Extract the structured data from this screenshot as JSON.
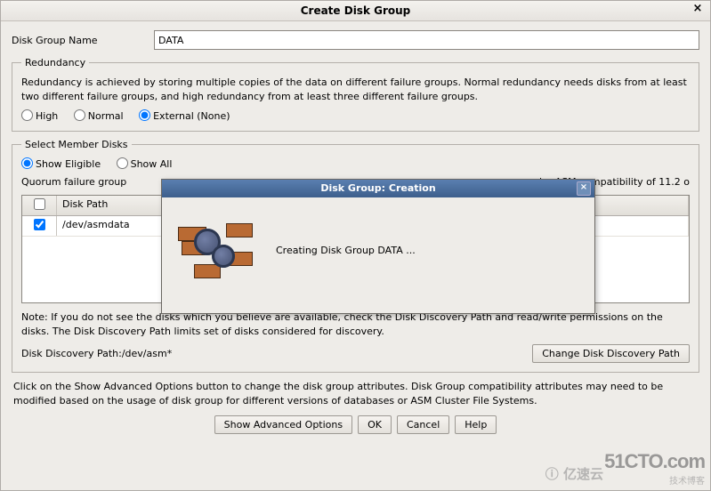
{
  "window": {
    "title": "Create Disk Group",
    "close_glyph": "×"
  },
  "form": {
    "name_label": "Disk Group Name",
    "name_value": "DATA"
  },
  "redundancy": {
    "legend": "Redundancy",
    "desc": "Redundancy is achieved by storing multiple copies of the data on different failure groups. Normal redundancy needs disks from at least two different failure groups, and high redundancy from at least three different failure groups.",
    "high_label": "High",
    "normal_label": "Normal",
    "external_label": "External (None)",
    "selected": "external"
  },
  "member": {
    "legend": "Select Member Disks",
    "show_eligible_label": "Show Eligible",
    "show_all_label": "Show All",
    "selected": "eligible",
    "quorum_line": "Quorum failure group",
    "quorum_tail": "quire ASM compatibility of 11.2 o",
    "col_path": "Disk Path",
    "rows": [
      {
        "checked": true,
        "path": "/dev/asmdata"
      }
    ],
    "note": "Note: If you do not see the disks which you believe are available, check the Disk Discovery Path and read/write permissions on the disks. The Disk Discovery Path limits set of disks considered for discovery.",
    "disc_path_label": "Disk Discovery Path:",
    "disc_path_value": "/dev/asm*",
    "change_path_btn": "Change Disk Discovery Path"
  },
  "footer": {
    "text": "Click on the Show Advanced Options button to change the disk group attributes. Disk Group compatibility attributes may need to be modified based on the usage of disk group for different versions of databases or ASM Cluster File Systems.",
    "adv_btn": "Show Advanced Options",
    "ok_btn": "OK",
    "cancel_btn": "Cancel",
    "help_btn": "Help"
  },
  "modal": {
    "title": "Disk Group: Creation",
    "close_glyph": "×",
    "message": "Creating Disk Group DATA ..."
  },
  "watermark": {
    "brand": "51CTO.com",
    "sub": "技术博客",
    "left": "亿速云"
  }
}
